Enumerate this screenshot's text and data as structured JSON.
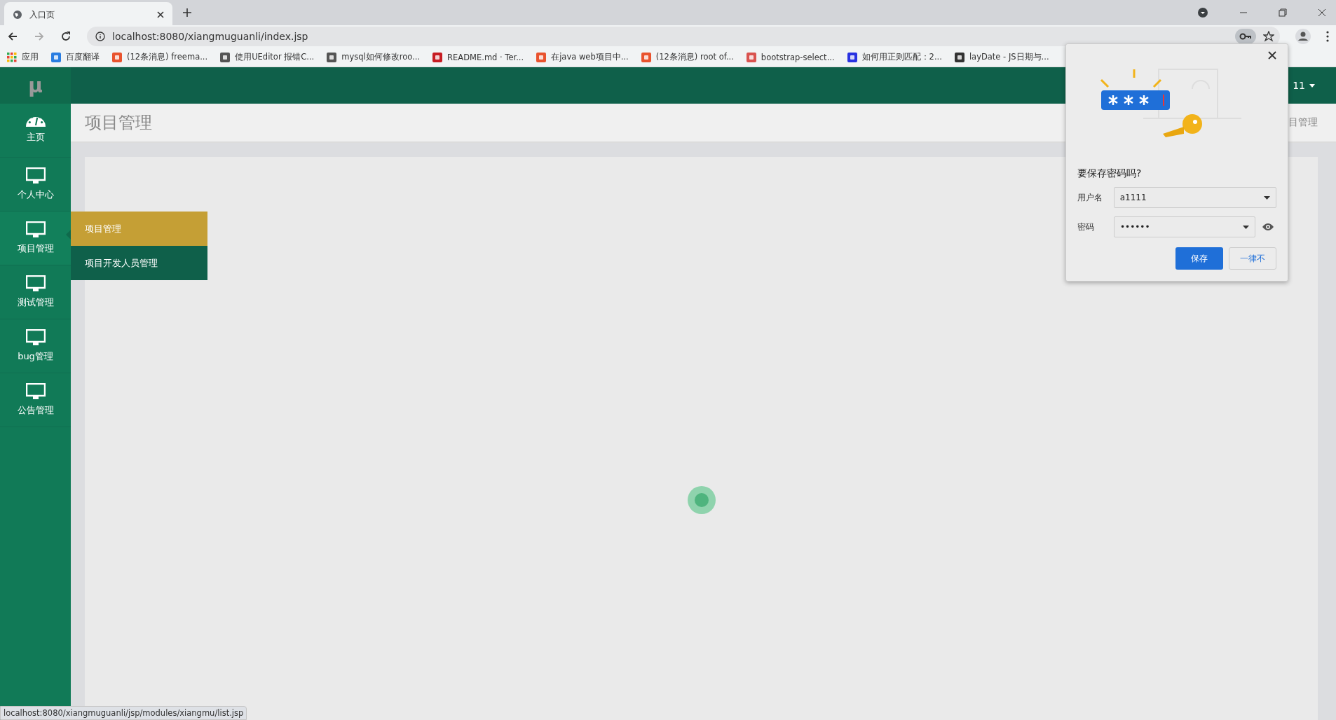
{
  "browser": {
    "tab": {
      "title": "入口页"
    },
    "url": "localhost:8080/xiangmuguanli/index.jsp",
    "bookmarks": [
      {
        "kind": "apps",
        "label": "应用"
      },
      {
        "kind": "translate",
        "label": "百度翻译"
      },
      {
        "kind": "csdn",
        "label": "(12条消息) freema..."
      },
      {
        "kind": "editor",
        "label": "使用UEditor 报错C..."
      },
      {
        "kind": "editor",
        "label": "mysql如何修改roo..."
      },
      {
        "kind": "gitee",
        "label": "README.md · Ter..."
      },
      {
        "kind": "csdn",
        "label": "在java web项目中..."
      },
      {
        "kind": "csdn",
        "label": "(12条消息) root of..."
      },
      {
        "kind": "jian",
        "label": "bootstrap-select..."
      },
      {
        "kind": "baidu",
        "label": "如何用正则匹配：2..."
      },
      {
        "kind": "laydate",
        "label": "layDate - JS日期与..."
      }
    ],
    "status_url": "localhost:8080/xiangmuguanli/jsp/modules/xiangmu/list.jsp"
  },
  "app": {
    "logo": "μ",
    "user": "11",
    "page_title": "项目管理",
    "breadcrumb": "目管理",
    "sidebar": [
      {
        "kind": "dashboard",
        "label": "主页",
        "selected": false
      },
      {
        "kind": "monitor",
        "label": "个人中心",
        "selected": false
      },
      {
        "kind": "monitor",
        "label": "项目管理",
        "selected": true
      },
      {
        "kind": "monitor",
        "label": "测试管理",
        "selected": false
      },
      {
        "kind": "monitor",
        "label": "bug管理",
        "selected": false
      },
      {
        "kind": "monitor",
        "label": "公告管理",
        "selected": false
      }
    ],
    "submenu": [
      {
        "label": "项目管理",
        "selected": true
      },
      {
        "label": "项目开发人员管理",
        "selected": false
      }
    ]
  },
  "password_dialog": {
    "title": "要保存密码吗?",
    "username_label": "用户名",
    "username": "a1111",
    "password_label": "密码",
    "password": "••••••",
    "save": "保存",
    "never": "一律不"
  }
}
